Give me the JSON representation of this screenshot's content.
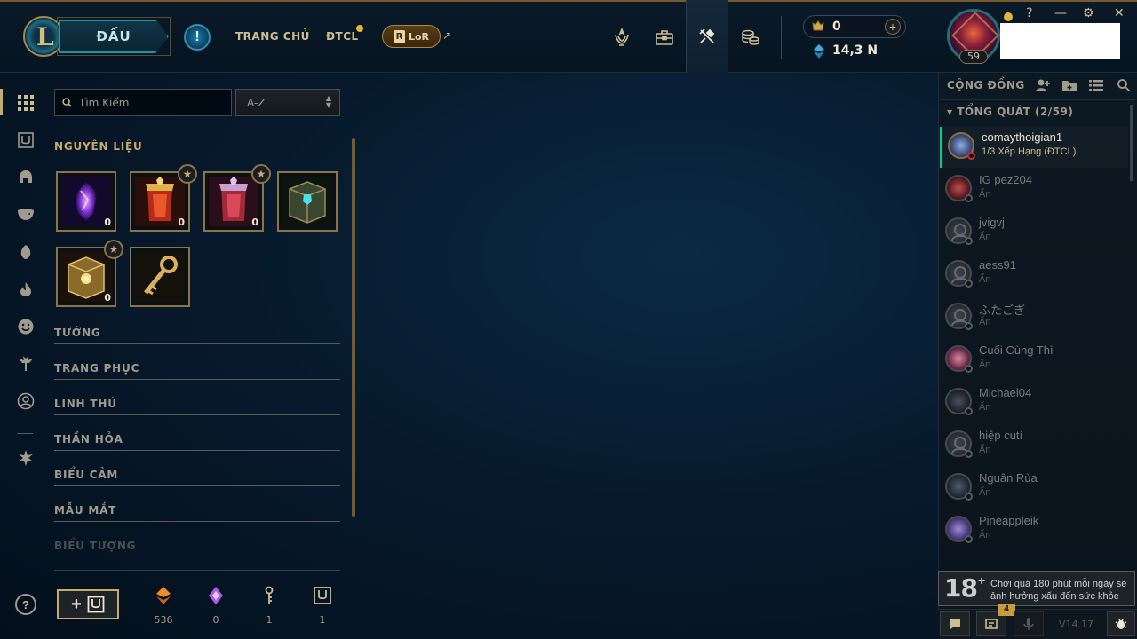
{
  "top_nav": {
    "play_label": "ĐẤU",
    "home_label": "TRANG CHỦ",
    "tft_label": "ĐTCL",
    "lor_label": "LoR",
    "lor_badge": "R",
    "alert_symbol": "!",
    "external_symbol": "↗"
  },
  "top_icons": [
    "ranked-icon",
    "collection-icon",
    "loot-icon",
    "store-icon"
  ],
  "currency": {
    "rp_value": "0",
    "be_value": "14,3 N",
    "plus_symbol": "+"
  },
  "profile": {
    "level": "59"
  },
  "window_controls": {
    "help": "?",
    "minimize": "—",
    "settings": "⚙",
    "close": "✕"
  },
  "loot": {
    "search_placeholder": "Tìm Kiếm",
    "sort_label": "A-Z",
    "sections": {
      "materials": "NGUYÊN LIỆU",
      "champions": "TƯỚNG",
      "skins": "TRANG PHỤC",
      "pets": "LINH THÚ",
      "summoner_icons": "THẦN HỎA",
      "emotes": "BIỂU CẢM",
      "ward_skins": "MẪU MẮT",
      "icons": "BIỂU TƯỢNG"
    },
    "materials_items": [
      {
        "name": "mythic-essence",
        "count": "0",
        "star": false
      },
      {
        "name": "event-chest-1",
        "count": "0",
        "star": true
      },
      {
        "name": "event-chest-2",
        "count": "0",
        "star": true
      },
      {
        "name": "hextech-chest",
        "count": "",
        "star": false
      },
      {
        "name": "masterwork-chest",
        "count": "0",
        "star": true
      },
      {
        "name": "key",
        "count": "",
        "star": false
      }
    ],
    "footer": {
      "craft_plus": "+",
      "orange_essence": "536",
      "mythic_essence": "0",
      "key_fragments": "1",
      "chests": "1"
    }
  },
  "social": {
    "title": "CỘNG ĐỒNG",
    "group_label": "TỔNG QUÁT (2/59)",
    "friends": [
      {
        "name": "comaythoigian1",
        "status": "1/3 Xếp Hạng (ĐTCL)"
      },
      {
        "name": "IG pez204",
        "status": "Ẩn"
      },
      {
        "name": "jvigvj",
        "status": "Ẩn"
      },
      {
        "name": "aess91",
        "status": "Ẩn"
      },
      {
        "name": "ふたごぎ",
        "status": "Ẩn"
      },
      {
        "name": "Cuối Cùng Thì",
        "status": "Ẩn"
      },
      {
        "name": "Michael04",
        "status": "Ẩn"
      },
      {
        "name": "hiệp cutí",
        "status": "Ẩn"
      },
      {
        "name": "Nguân Rùa",
        "status": "Ẩn"
      },
      {
        "name": "Pineappleik",
        "status": "Ẩn"
      }
    ],
    "age_notice": {
      "rating": "18",
      "plus": "+",
      "text": "Chơi quá 180 phút mỗi ngày sẽ ảnh hưởng xấu đến sức khỏe"
    },
    "missions_badge": "4",
    "version": "V14.17"
  },
  "colors": {
    "gold": "#c8aa6e",
    "teal": "#1b94a8",
    "online_green": "#0acb8a",
    "background": "#071a2d"
  }
}
